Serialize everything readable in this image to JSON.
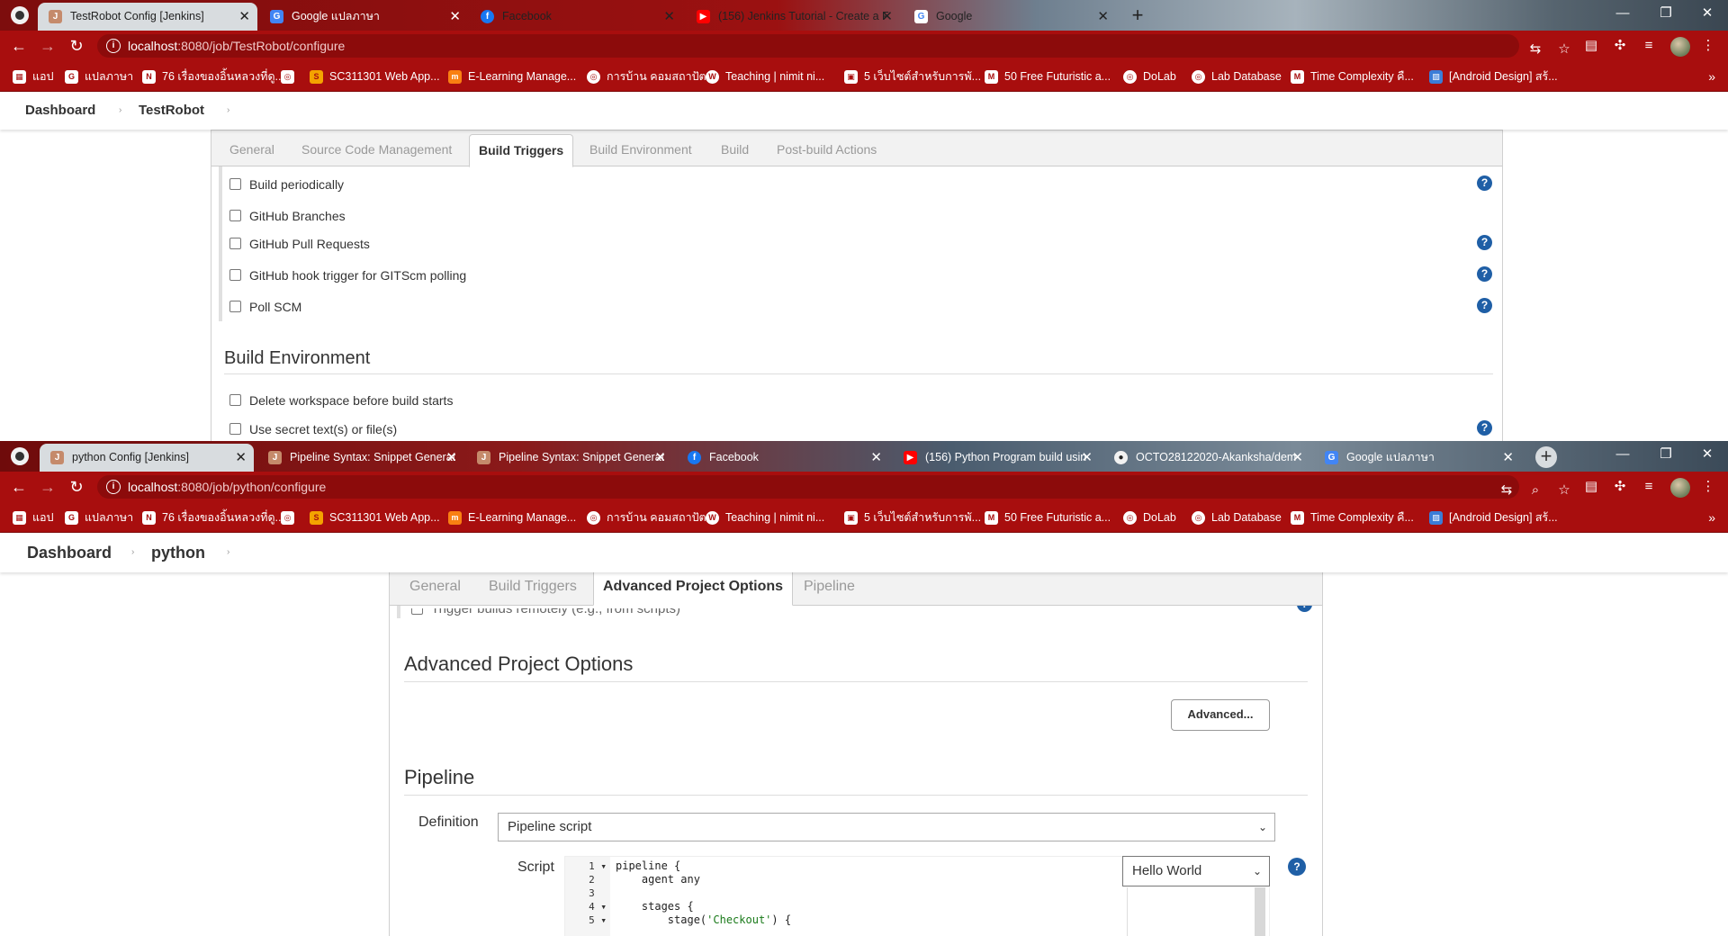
{
  "top": {
    "tabs": [
      {
        "label": "TestRobot Config [Jenkins]",
        "active": true
      },
      {
        "label": "Google แปลภาษา"
      },
      {
        "label": "Facebook"
      },
      {
        "label": "(156) Jenkins Tutorial - Create a F"
      },
      {
        "label": "Google"
      }
    ],
    "url_host": "localhost",
    "url_path": ":8080/job/TestRobot/configure",
    "breadcrumb": {
      "dashboard": "Dashboard",
      "job": "TestRobot"
    },
    "config_tabs": [
      "General",
      "Source Code Management",
      "Build Triggers",
      "Build Environment",
      "Build",
      "Post-build Actions"
    ],
    "active_config_tab": "Build Triggers",
    "triggers": [
      {
        "label": "Build periodically",
        "help": true
      },
      {
        "label": "GitHub Branches",
        "help": false
      },
      {
        "label": "GitHub Pull Requests",
        "help": true
      },
      {
        "label": "GitHub hook trigger for GITScm polling",
        "help": true
      },
      {
        "label": "Poll SCM",
        "help": true
      }
    ],
    "build_env_title": "Build Environment",
    "build_env": [
      {
        "label": "Delete workspace before build starts",
        "help": false
      },
      {
        "label": "Use secret text(s) or file(s)",
        "help": true
      }
    ]
  },
  "bottom": {
    "tabs": [
      {
        "label": "python Config [Jenkins]",
        "active": true
      },
      {
        "label": "Pipeline Syntax: Snippet Generat"
      },
      {
        "label": "Pipeline Syntax: Snippet Generat"
      },
      {
        "label": "Facebook"
      },
      {
        "label": "(156) Python Program build usin"
      },
      {
        "label": "OCTO28122020-Akanksha/dem"
      },
      {
        "label": "Google แปลภาษา"
      }
    ],
    "url_host": "localhost",
    "url_path": ":8080/job/python/configure",
    "breadcrumb": {
      "dashboard": "Dashboard",
      "job": "python"
    },
    "config_tabs": [
      "General",
      "Build Triggers",
      "Advanced Project Options",
      "Pipeline"
    ],
    "active_config_tab": "Advanced Project Options",
    "partial_row": "Trigger builds remotely (e.g., from scripts)",
    "adv_title": "Advanced Project Options",
    "advanced_button": "Advanced...",
    "pipeline_title": "Pipeline",
    "definition_label": "Definition",
    "definition_value": "Pipeline script",
    "script_label": "Script",
    "script_sample": "Hello World",
    "code_lines": [
      {
        "n": "1",
        "fold": true,
        "text": "pipeline {"
      },
      {
        "n": "2",
        "fold": false,
        "text": "    agent any"
      },
      {
        "n": "3",
        "fold": false,
        "text": ""
      },
      {
        "n": "4",
        "fold": true,
        "text": "    stages {"
      },
      {
        "n": "5",
        "fold": true,
        "text": "        stage('Checkout') {"
      }
    ]
  },
  "bookmarks": [
    {
      "label": "แอป",
      "icon": "apps-icon"
    },
    {
      "label": "แปลภาษา",
      "icon": "translate-icon"
    },
    {
      "label": "76 เรื่องของอิ้นหลวงที่ดู...",
      "icon": "news-icon"
    },
    {
      "label": "",
      "icon": "globe-icon"
    },
    {
      "label": "SC311301 Web App...",
      "icon": "course-icon"
    },
    {
      "label": "E-Learning Manage...",
      "icon": "moodle-icon"
    },
    {
      "label": "การบ้าน คอมสถาปัต",
      "icon": "globe-icon"
    },
    {
      "label": "Teaching | nimit ni...",
      "icon": "wordpress-icon"
    },
    {
      "label": "5 เว็บไซต์สำหรับการพั...",
      "icon": "site-icon"
    },
    {
      "label": "50 Free Futuristic a...",
      "icon": "medium-icon"
    },
    {
      "label": "DoLab",
      "icon": "globe-icon"
    },
    {
      "label": "Lab Database",
      "icon": "globe-icon"
    },
    {
      "label": "Time Complexity คื...",
      "icon": "medium-icon"
    },
    {
      "label": "[Android Design] สร้...",
      "icon": "image-icon"
    }
  ],
  "colors": {
    "chrome_red": "#a80e0e",
    "help_blue": "#1f5fa6"
  }
}
